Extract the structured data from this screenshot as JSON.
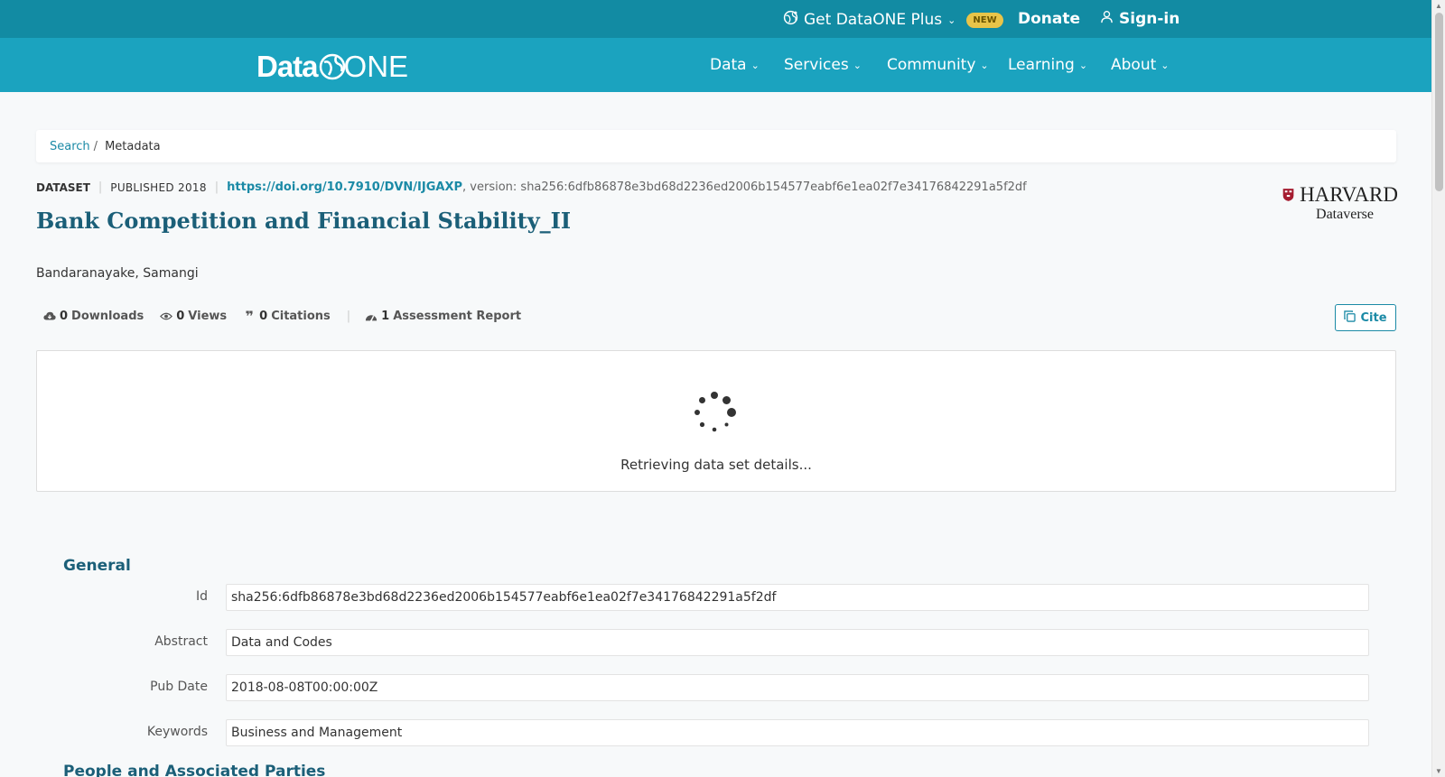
{
  "topbar": {
    "plus_label": "Get DataONE Plus",
    "new_badge": "NEW",
    "donate_label": "Donate",
    "signin_label": "Sign-in"
  },
  "logo": {
    "data": "Data",
    "one": "ONE"
  },
  "nav": {
    "items": [
      "Data",
      "Services",
      "Community",
      "Learning",
      "About"
    ]
  },
  "breadcrumb": {
    "search": "Search",
    "separator": "/",
    "current": "Metadata"
  },
  "dataset": {
    "type": "DATASET",
    "published": "PUBLISHED 2018",
    "doi": "https://doi.org/10.7910/DVN/IJGAXP",
    "version_text": ", version: sha256:6dfb86878e3bd68d2236ed2006b154577eabf6e1ea02f7e34176842291a5f2df",
    "title": "Bank Competition and Financial Stability_II",
    "author": "Bandaranayake, Samangi"
  },
  "repository": {
    "name_line1": "HARVARD",
    "name_line2": "Dataverse"
  },
  "stats": {
    "downloads_count": "0",
    "downloads_label": "Downloads",
    "views_count": "0",
    "views_label": "Views",
    "citations_count": "0",
    "citations_label": "Citations",
    "assessment_count": "1",
    "assessment_label": "Assessment Report"
  },
  "cite_label": "Cite",
  "loading_text": "Retrieving data set details...",
  "general": {
    "heading": "General",
    "fields": [
      {
        "label": "Id",
        "value": "sha256:6dfb86878e3bd68d2236ed2006b154577eabf6e1ea02f7e34176842291a5f2df"
      },
      {
        "label": "Abstract",
        "value": "Data and Codes"
      },
      {
        "label": "Pub Date",
        "value": "2018-08-08T00:00:00Z"
      },
      {
        "label": "Keywords",
        "value": "Business and Management"
      }
    ]
  },
  "people_heading": "People and Associated Parties",
  "colors": {
    "topbar": "#128ba3",
    "navbar": "#1ba3bf",
    "link": "#1b8aa6",
    "heading": "#1b5f78",
    "badge": "#e8c449"
  },
  "icons": [
    "globe-icon",
    "user-icon",
    "chevron-down-icon",
    "cloud-download-icon",
    "eye-icon",
    "quote-icon",
    "gauge-icon",
    "copy-icon",
    "spinner-icon",
    "harvard-shield-icon"
  ]
}
